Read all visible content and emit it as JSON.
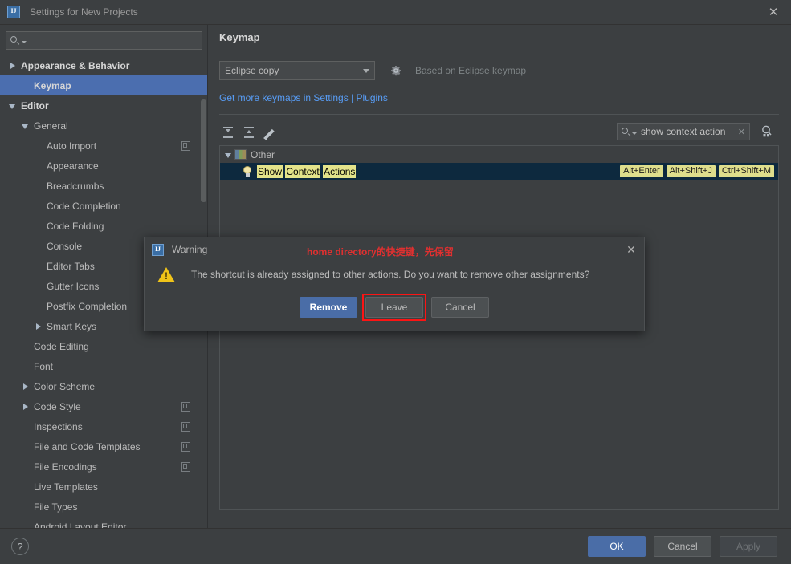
{
  "window": {
    "title": "Settings for New Projects",
    "app_icon": "intellij-idea-icon",
    "close_icon": "✕"
  },
  "sidebar": {
    "search": {
      "placeholder": "",
      "value": "",
      "icon": "search-icon"
    },
    "items": [
      {
        "label": "Appearance & Behavior",
        "indent": 0,
        "arrow": "collapsed",
        "bold": true,
        "selected": false,
        "copy": false
      },
      {
        "label": "Keymap",
        "indent": 1,
        "arrow": "none",
        "bold": true,
        "selected": true,
        "copy": false
      },
      {
        "label": "Editor",
        "indent": 0,
        "arrow": "expanded",
        "bold": true,
        "selected": false,
        "copy": false
      },
      {
        "label": "General",
        "indent": 1,
        "arrow": "expanded",
        "bold": false,
        "selected": false,
        "copy": false
      },
      {
        "label": "Auto Import",
        "indent": 2,
        "arrow": "none",
        "bold": false,
        "selected": false,
        "copy": true
      },
      {
        "label": "Appearance",
        "indent": 2,
        "arrow": "none",
        "bold": false,
        "selected": false,
        "copy": false
      },
      {
        "label": "Breadcrumbs",
        "indent": 2,
        "arrow": "none",
        "bold": false,
        "selected": false,
        "copy": false
      },
      {
        "label": "Code Completion",
        "indent": 2,
        "arrow": "none",
        "bold": false,
        "selected": false,
        "copy": false
      },
      {
        "label": "Code Folding",
        "indent": 2,
        "arrow": "none",
        "bold": false,
        "selected": false,
        "copy": false
      },
      {
        "label": "Console",
        "indent": 2,
        "arrow": "none",
        "bold": false,
        "selected": false,
        "copy": false
      },
      {
        "label": "Editor Tabs",
        "indent": 2,
        "arrow": "none",
        "bold": false,
        "selected": false,
        "copy": false
      },
      {
        "label": "Gutter Icons",
        "indent": 2,
        "arrow": "none",
        "bold": false,
        "selected": false,
        "copy": false
      },
      {
        "label": "Postfix Completion",
        "indent": 2,
        "arrow": "none",
        "bold": false,
        "selected": false,
        "copy": false
      },
      {
        "label": "Smart Keys",
        "indent": 2,
        "arrow": "collapsed",
        "bold": false,
        "selected": false,
        "copy": false
      },
      {
        "label": "Code Editing",
        "indent": 1,
        "arrow": "none",
        "bold": false,
        "selected": false,
        "copy": false
      },
      {
        "label": "Font",
        "indent": 1,
        "arrow": "none",
        "bold": false,
        "selected": false,
        "copy": false
      },
      {
        "label": "Color Scheme",
        "indent": 1,
        "arrow": "collapsed",
        "bold": false,
        "selected": false,
        "copy": false
      },
      {
        "label": "Code Style",
        "indent": 1,
        "arrow": "collapsed",
        "bold": false,
        "selected": false,
        "copy": true
      },
      {
        "label": "Inspections",
        "indent": 1,
        "arrow": "none",
        "bold": false,
        "selected": false,
        "copy": true
      },
      {
        "label": "File and Code Templates",
        "indent": 1,
        "arrow": "none",
        "bold": false,
        "selected": false,
        "copy": true
      },
      {
        "label": "File Encodings",
        "indent": 1,
        "arrow": "none",
        "bold": false,
        "selected": false,
        "copy": true
      },
      {
        "label": "Live Templates",
        "indent": 1,
        "arrow": "none",
        "bold": false,
        "selected": false,
        "copy": false
      },
      {
        "label": "File Types",
        "indent": 1,
        "arrow": "none",
        "bold": false,
        "selected": false,
        "copy": false
      },
      {
        "label": "Android Layout Editor",
        "indent": 1,
        "arrow": "none",
        "bold": false,
        "selected": false,
        "copy": false
      }
    ]
  },
  "main": {
    "title": "Keymap",
    "keymap_select": {
      "value": "Eclipse copy",
      "arrow_icon": "chevron-down-icon"
    },
    "gear_icon": "gear-icon",
    "based_on": "Based on Eclipse keymap",
    "plugins_link": "Get more keymaps in Settings | Plugins",
    "toolbar": {
      "expand_all_icon": "expand-all-icon",
      "collapse_all_icon": "collapse-all-icon",
      "edit_icon": "pencil-icon",
      "search": {
        "value": "show context action",
        "clear_icon": "✕",
        "search_icon": "search-icon"
      },
      "filter_icon": "find-shortcut-icon"
    },
    "tree": {
      "group": {
        "label": "Other",
        "icon": "plugin-folder-icon",
        "expanded": true
      },
      "action": {
        "icon": "lightbulb-icon",
        "parts": [
          {
            "text": "Show",
            "highlight": true
          },
          {
            "text": " ",
            "highlight": false
          },
          {
            "text": "Context",
            "highlight": true
          },
          {
            "text": " ",
            "highlight": false
          },
          {
            "text": "Actions",
            "highlight": true
          }
        ],
        "shortcuts": [
          "Alt+Enter",
          "Alt+Shift+J",
          "Ctrl+Shift+M"
        ]
      }
    }
  },
  "dialog": {
    "icon": "intellij-idea-icon",
    "title": "Warning",
    "close_icon": "✕",
    "annotation": "home directory的快捷键，先保留",
    "annotation_color": "#e03030",
    "warning_icon": "warning-triangle-icon",
    "message": "The shortcut is already assigned to other actions. Do you want to remove other assignments?",
    "buttons": [
      {
        "label": "Remove",
        "primary": true,
        "annotated": false
      },
      {
        "label": "Leave",
        "primary": false,
        "annotated": true
      },
      {
        "label": "Cancel",
        "primary": false,
        "annotated": false
      }
    ]
  },
  "footer": {
    "help_icon": "?",
    "buttons": [
      {
        "label": "OK",
        "style": "primary"
      },
      {
        "label": "Cancel",
        "style": "normal"
      },
      {
        "label": "Apply",
        "style": "disabled"
      }
    ]
  }
}
